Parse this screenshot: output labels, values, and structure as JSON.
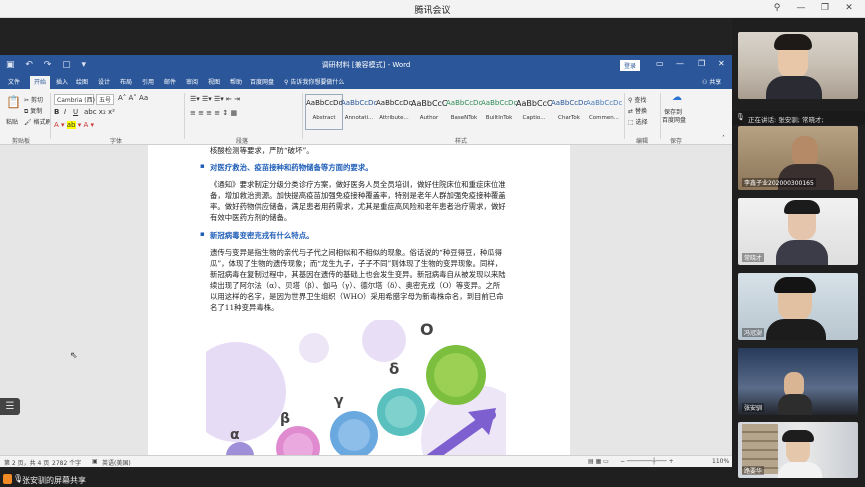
{
  "app": {
    "title": "腾讯会议",
    "share_indicator": "张安驯的屏幕共享"
  },
  "word": {
    "doc_title": "调研材料 [兼容模式] - Word",
    "login": "登录",
    "tabs": [
      "文件",
      "开始",
      "插入",
      "绘图",
      "设计",
      "布局",
      "引用",
      "邮件",
      "审阅",
      "视图",
      "帮助",
      "百度网盘"
    ],
    "tell_me": "告诉我你想要做什么",
    "share": "共享",
    "ribbon": {
      "paste": "粘贴",
      "cut": "剪切",
      "copy": "复制",
      "format_painter": "格式刷",
      "font_name": "Cambria (西)",
      "font_size": "五号",
      "groups": {
        "clipboard": "剪贴板",
        "font": "字体",
        "paragraph": "段落",
        "styles": "样式",
        "editing": "编辑",
        "save": "保存"
      },
      "styles": [
        {
          "preview": "AaBbCcDd",
          "name": "Abstract"
        },
        {
          "preview": "AaBbCcDc",
          "name": "Annotati..."
        },
        {
          "preview": "AaBbCcDc",
          "name": "Attribute..."
        },
        {
          "preview": "AaBbCcC",
          "name": "Author"
        },
        {
          "preview": "AaBbCcDc",
          "name": "BaseNTok"
        },
        {
          "preview": "AaBbCcDc",
          "name": "BuiltInTok"
        },
        {
          "preview": "AaBbCcC",
          "name": "Captio..."
        },
        {
          "preview": "AaBbCcDc",
          "name": "CharTok"
        },
        {
          "preview": "AaBbCcDc",
          "name": "Commen..."
        }
      ],
      "find": "查找",
      "replace": "替换",
      "select": "选择",
      "save_baidu_1": "保存到",
      "save_baidu_2": "百度网盘"
    },
    "content": {
      "line0": "核酸检测等要求，严防“破坏”。",
      "h1": "对医疗救治、疫苗接种和药物储备等方面的要求。",
      "p1": "《通知》要求制定分级分类诊疗方案，做好医务人员全员培训，做好住院床位和重症床位准备，增加救治资源。加快提高疫苗加强免疫接种覆盖率，特别是老年人群加强免疫接种覆盖率。做好药物供应储备，满足患者用药需求，尤其是重症高风险和老年患者治疗需求，做好有效中医药方剂的储备。",
      "h2": "新冠病毒变密克戎有什么特点。",
      "p2": "遗传与变异是指生物的亲代与子代之间相似和不相似的现象。俗话说的“种豆得豆，种瓜得瓜”，体现了生物的遗传现象；而“龙生九子，子子不同”则体现了生物的变异现象。同样，新冠病毒在复制过程中，其基因在遗传的基础上也会发生变异。新冠病毒自从被发现以来陆续出现了阿尔法（α）、贝塔（β）、伽马（γ）、德尔塔（δ）、奥密克戎（O）等变异。之所以用这样的名字，是因为世界卫生组织（WHO）采用希腊字母为新毒株命名，到目前已命名了11种变异毒株。"
    },
    "greek": {
      "omicron": "O",
      "delta": "δ",
      "gamma": "γ",
      "alpha": "α",
      "beta": "β"
    },
    "status": {
      "page": "第 2 页，共 4 页",
      "words": "2782 个字",
      "lang": "英语(美国)",
      "zoom": "110%"
    }
  },
  "participants": [
    {
      "name": ""
    },
    {
      "name": "李鑫子业202000300165"
    },
    {
      "name": "常晓才"
    },
    {
      "name": "冯冠澍"
    },
    {
      "name": "张安驯"
    },
    {
      "name": "路要华"
    }
  ],
  "speaking": "正在讲话: 张安驯; 常晓才;"
}
